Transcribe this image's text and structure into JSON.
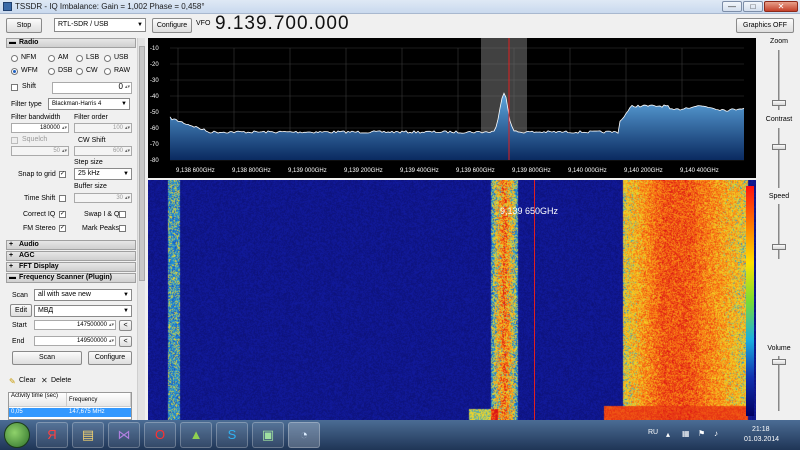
{
  "window": {
    "title": "TSSDR - IQ Imbalance: Gain = 1,002 Phase = 0,458°",
    "min": "—",
    "max": "□",
    "close": "✕"
  },
  "toolbar": {
    "stop_label": "Stop",
    "source_value": "RTL-SDR / USB",
    "configure_label": "Configure",
    "vfo_label": "VFO",
    "vfo_value": "9.139.700.000",
    "graphics_label": "Graphics OFF"
  },
  "radio": {
    "header": "Radio",
    "modes": [
      "NFM",
      "AM",
      "LSB",
      "USB",
      "WFM",
      "DSB",
      "CW",
      "RAW"
    ],
    "selected_mode": "WFM",
    "shift_label": "Shift",
    "shift_value": "0",
    "filter_type_label": "Filter type",
    "filter_type_value": "Blackman-Harris 4",
    "filter_bandwidth_label": "Filter bandwidth",
    "filter_bandwidth_value": "180000",
    "filter_order_label": "Filter order",
    "filter_order_value": "100",
    "squelch_label": "Squelch",
    "squelch_value": "50",
    "cw_shift_label": "CW Shift",
    "cw_shift_value": "600",
    "step_size_label": "Step size",
    "snap_label": "Snap to grid",
    "step_value": "25 kHz",
    "buffer_size_label": "Buffer size",
    "time_shift_label": "Time Shift",
    "buffer_value": "30",
    "correct_iq_label": "Correct IQ",
    "swap_iq_label": "Swap I & Q",
    "fm_stereo_label": "FM Stereo",
    "mark_peaks_label": "Mark Peaks"
  },
  "sections": {
    "audio": "Audio",
    "agc": "AGC",
    "fft": "FFT Display",
    "scanner": "Frequency Scanner (Plugin)"
  },
  "scanner": {
    "scan_label": "Scan",
    "scan_value": "all with save new",
    "edit_label": "Edit",
    "edit_value": "МВД",
    "start_label": "Start",
    "start_value": "147500000",
    "end_label": "End",
    "end_value": "149500000",
    "prev_label": "<",
    "scan_button": "Scan",
    "configure_button": "Configure",
    "clear_label": "Clear",
    "delete_label": "Delete",
    "col_activity": "Activity time (sec)",
    "col_frequency": "Frequency",
    "row_activity": "0,05",
    "row_frequency": "147,675 MHz"
  },
  "spectrum": {
    "y_ticks": [
      "-10",
      "-20",
      "-30",
      "-40",
      "-50",
      "-60",
      "-70",
      "-80"
    ],
    "x_ticks": [
      "9,138 600GHz",
      "9,138 800GHz",
      "9,139 000GHz",
      "9,139 200GHz",
      "9,139 400GHz",
      "9,139 600GHz",
      "9,139 800GHz",
      "9,140 000GHz",
      "9,140 200GHz",
      "9,140 400GHz"
    ]
  },
  "waterfall": {
    "marker_label": "9,139 650GHz"
  },
  "right": {
    "zoom": "Zoom",
    "contrast": "Contrast",
    "speed": "Speed",
    "volume": "Volume"
  },
  "taskbar": {
    "lang": "RU",
    "time": "21:18",
    "date": "01.03.2014",
    "apps": [
      "yandex-icon",
      "explorer-icon",
      "visual-studio-icon",
      "opera-icon",
      "android-icon",
      "skype-icon",
      "remote-desktop-icon",
      "sdr-icon"
    ]
  }
}
